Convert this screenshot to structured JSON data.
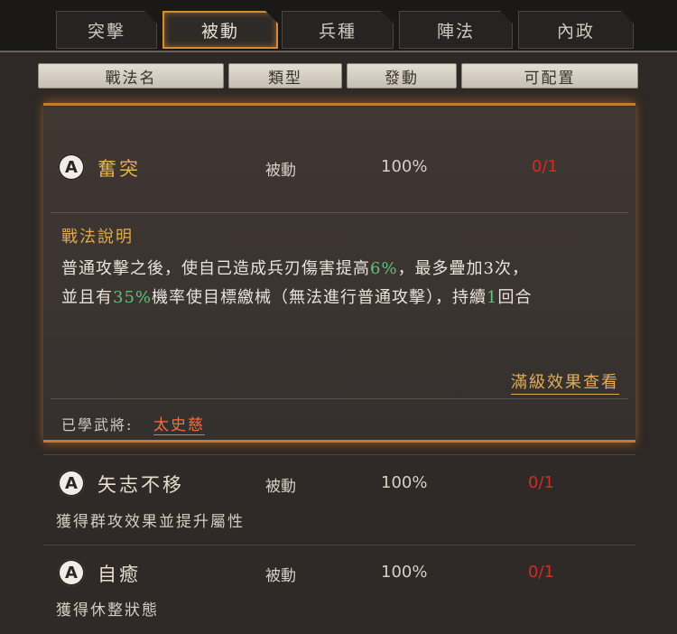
{
  "tabs": [
    {
      "label": "突擊",
      "active": false
    },
    {
      "label": "被動",
      "active": true
    },
    {
      "label": "兵種",
      "active": false
    },
    {
      "label": "陣法",
      "active": false
    },
    {
      "label": "內政",
      "active": false
    }
  ],
  "columns": {
    "name": "戰法名",
    "type": "類型",
    "trigger": "發動",
    "slots": "可配置"
  },
  "tactics": [
    {
      "grade": "A",
      "name": "奮突",
      "type": "被動",
      "rate": "100%",
      "slots": "0/1",
      "desc_title": "戰法說明",
      "desc_line1_a": "普通攻擊之後，使自己造成兵刃傷害提高",
      "desc_line1_hl": "6%",
      "desc_line1_b": "，最多疊加3次，",
      "desc_line2_a": "並且有",
      "desc_line2_hl": "35%",
      "desc_line2_b": "機率使目標繳械（無法進行普通攻擊），持續",
      "desc_line2_hl2": "1",
      "desc_line2_c": "回合",
      "full_effect_link": "滿級效果查看",
      "learned_label": "已學武將:",
      "learned_general": "太史慈"
    },
    {
      "grade": "A",
      "name": "矢志不移",
      "type": "被動",
      "rate": "100%",
      "slots": "0/1",
      "summary": "獲得群攻效果並提升屬性"
    },
    {
      "grade": "A",
      "name": "自癒",
      "type": "被動",
      "rate": "100%",
      "slots": "0/1",
      "summary": "獲得休整狀態"
    }
  ],
  "colors": {
    "accent": "#c57a33",
    "gold_text": "#e2b255",
    "highlight_green": "#5ec37a",
    "slot_red": "#d32d22",
    "general_orange": "#ff6a38"
  }
}
